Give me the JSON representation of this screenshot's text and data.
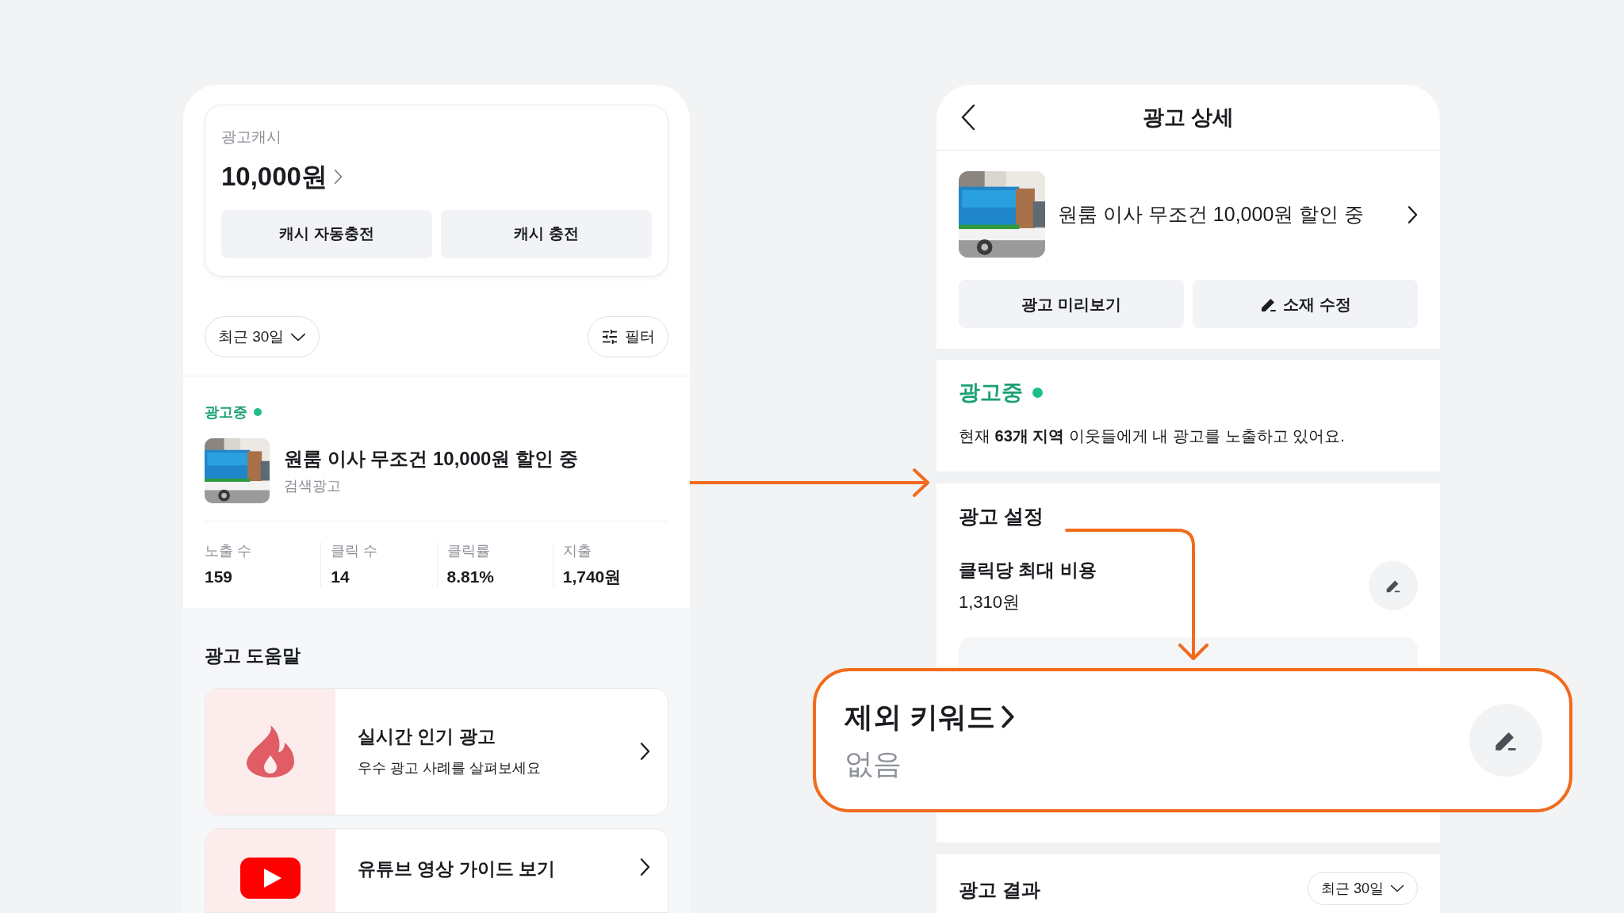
{
  "left_screen": {
    "cash_card": {
      "label": "광고캐시",
      "amount": "10,000원",
      "buttons": [
        "캐시 자동충전",
        "캐시 충전"
      ]
    },
    "period_dropdown": "최근 30일",
    "filter_button": "필터",
    "ad": {
      "status": "광고중",
      "active": true,
      "title": "원룸 이사 무조건 10,000원 할인 중",
      "type": "검색광고",
      "stats": [
        {
          "label": "노출 수",
          "value": "159"
        },
        {
          "label": "클릭 수",
          "value": "14"
        },
        {
          "label": "클릭률",
          "value": "8.81%"
        },
        {
          "label": "지출",
          "value": "1,740원"
        }
      ]
    },
    "help": {
      "title": "광고 도움말",
      "items": [
        {
          "kind": "fire",
          "title": "실시간 인기 광고",
          "subtitle": "우수 광고 사례를 살펴보세요"
        },
        {
          "kind": "video",
          "title": "유튜브 영상 가이드 보기"
        }
      ]
    }
  },
  "right_screen": {
    "title": "광고 상세",
    "ad_title": "원룸 이사 무조건 10,000원 할인 중",
    "buttons": [
      {
        "kind": "preview",
        "label": "광고 미리보기"
      },
      {
        "kind": "edit",
        "label": "소재 수정"
      }
    ],
    "status": "광고중",
    "active": true,
    "status_message": "현재 **63개 지역** 이웃들에게 내 광고를 노출하고 있어요.",
    "settings": {
      "title": "광고 설정",
      "items": [
        {
          "label": "클릭당 최대 비용",
          "value": "1,310원"
        }
      ]
    },
    "results": {
      "title": "광고 결과",
      "period": "최근 30일"
    }
  },
  "callout": {
    "label": "제외 키워드",
    "value": "없음"
  }
}
